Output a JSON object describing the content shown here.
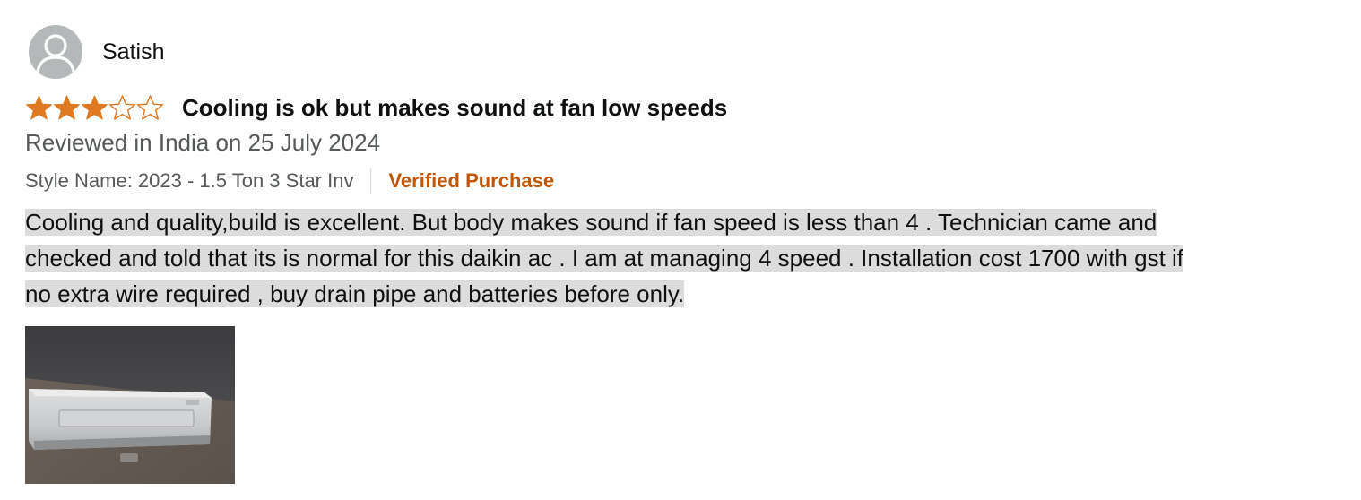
{
  "reviewer": {
    "name": "Satish",
    "avatar_icon": "default-user-avatar-icon"
  },
  "rating": {
    "value": 3,
    "max": 5,
    "star_color": "#de7921"
  },
  "review": {
    "title": "Cooling is ok but makes sound at fan low speeds",
    "date_text": "Reviewed in India on 25 July 2024",
    "style_name": "Style Name: 2023 - 1.5 Ton 3 Star Inv",
    "verified_label": "Verified Purchase",
    "verified_color": "#c45500",
    "body": "Cooling and quality,build is excellent. But body makes sound if fan speed is less than 4 . Technician came and checked and told that its is normal for this daikin ac . I am at managing 4 speed . Installation cost 1700 with gst if no extra wire required , buy drain pipe and batteries before only."
  },
  "media": {
    "thumbnail_icon": "air-conditioner-photo"
  }
}
